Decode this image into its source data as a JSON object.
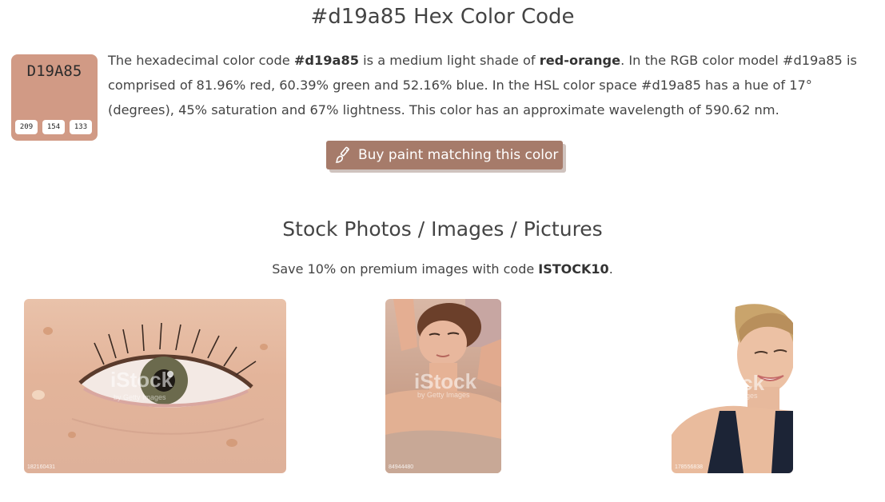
{
  "colors": {
    "swatch": "#d19a85",
    "button": "#a67b6a",
    "text": "#444444"
  },
  "header": {
    "title": "#d19a85 Hex Color Code"
  },
  "swatch": {
    "hex": "D19A85",
    "r": "209",
    "g": "154",
    "b": "133"
  },
  "description": {
    "t1": "The hexadecimal color code ",
    "code1": "#d19a85",
    "t2": " is a medium light shade of ",
    "shade": "red-orange",
    "t3": ". In the RGB color model #d19a85 is comprised of 81.96% red, 60.39% green and 52.16% blue. In the HSL color space #d19a85 has a hue of 17° (degrees), 45% saturation and 67% lightness. This color has an approximate wavelength of 590.62 nm."
  },
  "buy_button": {
    "label": "Buy paint matching this color",
    "icon": "paint-brush-icon"
  },
  "stock": {
    "title": "Stock Photos / Images / Pictures",
    "promo_pre": "Save 10% on premium images with code ",
    "promo_code": "ISTOCK10",
    "promo_post": "."
  },
  "photos": [
    {
      "subject": "eye close-up",
      "watermark": "iStock",
      "watermark_sub": "by Getty Images",
      "id": "182160431"
    },
    {
      "subject": "woman receiving facial massage",
      "watermark": "iStock",
      "watermark_sub": "by Getty Images",
      "id": "84944480"
    },
    {
      "subject": "smiling blonde woman",
      "watermark": "iStock",
      "watermark_sub": "by Getty Images",
      "id": "178556838"
    }
  ]
}
